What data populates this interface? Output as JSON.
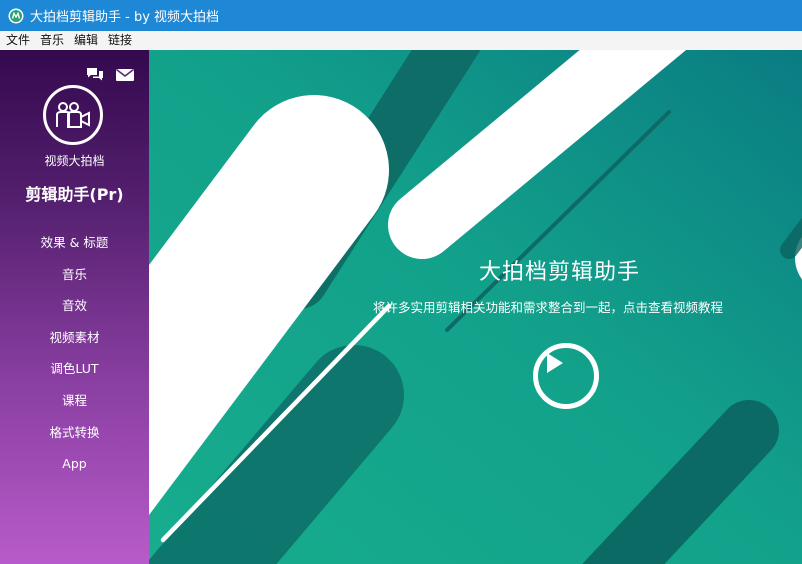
{
  "window": {
    "title": "大拍档剪辑助手 - by 视频大拍档"
  },
  "menu": [
    "文件",
    "音乐",
    "编辑",
    "链接"
  ],
  "sidebar": {
    "brand_sub": "视频大拍档",
    "brand_main": "剪辑助手(Pr)",
    "items": [
      "效果 & 标题",
      "音乐",
      "音效",
      "视频素材",
      "调色LUT",
      "课程",
      "格式转换",
      "App"
    ]
  },
  "hero": {
    "title": "大拍档剪辑助手",
    "subtitle": "将许多实用剪辑相关功能和需求整合到一起，点击查看视频教程"
  },
  "colors": {
    "titlebar": "#1e88d6",
    "sidebar_top": "#34094e",
    "sidebar_bottom": "#b85bca",
    "hero_light": "#16a98d",
    "hero_dark": "#0b7e83"
  }
}
